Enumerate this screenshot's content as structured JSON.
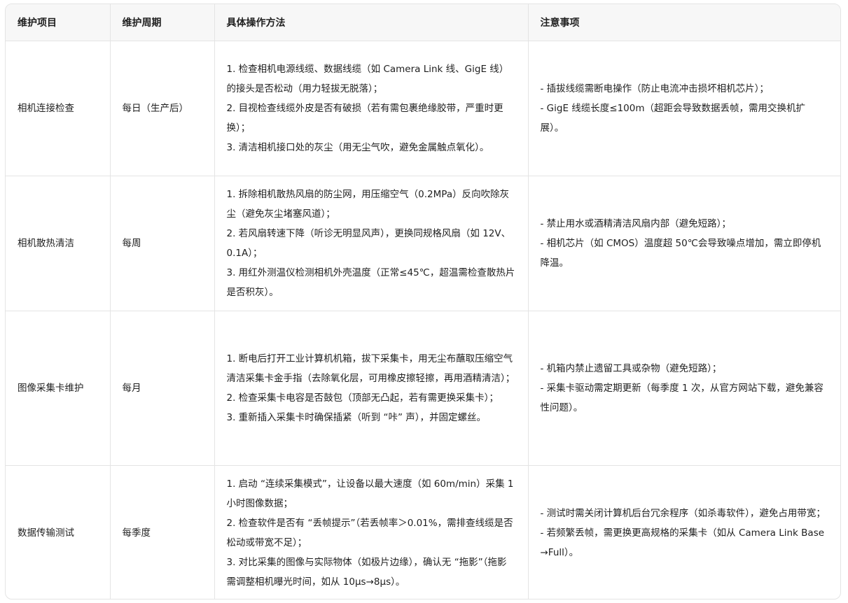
{
  "headers": {
    "item": "维护项目",
    "cycle": "维护周期",
    "method": "具体操作方法",
    "notes": "注意事项"
  },
  "rows": [
    {
      "item": "相机连接检查",
      "cycle": "每日（生产后）",
      "method": [
        "1. 检查相机电源线缆、数据线缆（如 Camera Link 线、GigE 线）的接头是否松动（用力轻拔无脱落）；",
        "2. 目视检查线缆外皮是否有破损（若有需包裹绝缘胶带，严重时更换）；",
        "3. 清洁相机接口处的灰尘（用无尘气吹，避免金属触点氧化）。"
      ],
      "notes": [
        "- 插拔线缆需断电操作（防止电流冲击损坏相机芯片）；",
        "- GigE 线缆长度≤100m（超距会导致数据丢帧，需用交换机扩展）。"
      ]
    },
    {
      "item": "相机散热清洁",
      "cycle": "每周",
      "method": [
        "1. 拆除相机散热风扇的防尘网，用压缩空气（0.2MPa）反向吹除灰尘（避免灰尘堵塞风道）；",
        "2. 若风扇转速下降（听诊无明显风声），更换同规格风扇（如 12V、0.1A）；",
        "3. 用红外测温仪检测相机外壳温度（正常≤45℃，超温需检查散热片是否积灰）。"
      ],
      "notes": [
        "- 禁止用水或酒精清洁风扇内部（避免短路）；",
        "- 相机芯片（如 CMOS）温度超 50℃会导致噪点增加，需立即停机降温。"
      ]
    },
    {
      "item": "图像采集卡维护",
      "cycle": "每月",
      "method": [
        "1. 断电后打开工业计算机机箱，拔下采集卡，用无尘布蘸取压缩空气清洁采集卡金手指（去除氧化层，可用橡皮擦轻擦，再用酒精清洁）；",
        "2. 检查采集卡电容是否鼓包（顶部无凸起，若有需更换采集卡）；",
        "3. 重新插入采集卡时确保插紧（听到 “咔” 声），并固定螺丝。"
      ],
      "notes": [
        "- 机箱内禁止遗留工具或杂物（避免短路）；",
        "- 采集卡驱动需定期更新（每季度 1 次，从官方网站下载，避免兼容性问题）。"
      ]
    },
    {
      "item": "数据传输测试",
      "cycle": "每季度",
      "method": [
        "1. 启动 “连续采集模式”，让设备以最大速度（如 60m/min）采集 1 小时图像数据；",
        "2. 检查软件是否有 “丢帧提示”（若丢帧率＞0.01%，需排查线缆是否松动或带宽不足）；",
        "3. 对比采集的图像与实际物体（如极片边缘），确认无 “拖影”（拖影需调整相机曝光时间，如从 10μs→8μs）。"
      ],
      "notes": [
        "- 测试时需关闭计算机后台冗余程序（如杀毒软件），避免占用带宽；",
        "- 若频繁丢帧，需更换更高规格的采集卡（如从 Camera Link Base→Full）。"
      ]
    }
  ]
}
